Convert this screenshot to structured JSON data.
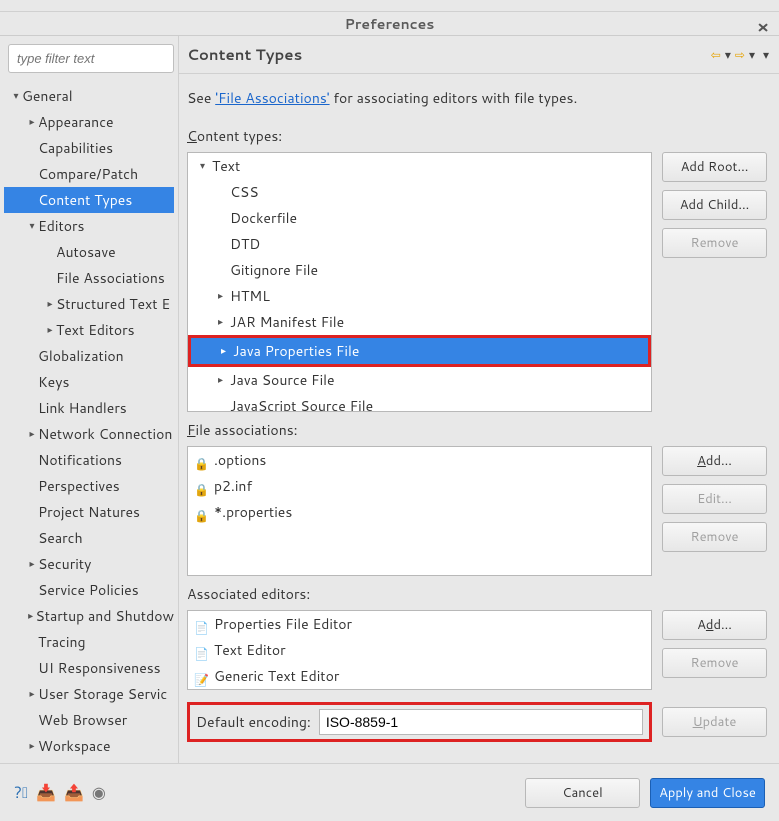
{
  "window": {
    "title": "Preferences"
  },
  "sidebar": {
    "filter_placeholder": "type filter text",
    "tree": {
      "general": {
        "label": "General",
        "children": [
          {
            "label": "Appearance"
          },
          {
            "label": "Capabilities"
          },
          {
            "label": "Compare/Patch"
          },
          {
            "label": "Content Types"
          },
          {
            "label": "Editors",
            "children": [
              {
                "label": "Autosave"
              },
              {
                "label": "File Associations"
              },
              {
                "label": "Structured Text E"
              },
              {
                "label": "Text Editors"
              }
            ]
          },
          {
            "label": "Globalization"
          },
          {
            "label": "Keys"
          },
          {
            "label": "Link Handlers"
          },
          {
            "label": "Network Connection"
          },
          {
            "label": "Notifications"
          },
          {
            "label": "Perspectives"
          },
          {
            "label": "Project Natures"
          },
          {
            "label": "Search"
          },
          {
            "label": "Security"
          },
          {
            "label": "Service Policies"
          },
          {
            "label": "Startup and Shutdow"
          },
          {
            "label": "Tracing"
          },
          {
            "label": "UI Responsiveness"
          },
          {
            "label": "User Storage Servic"
          },
          {
            "label": "Web Browser"
          },
          {
            "label": "Workspace"
          }
        ]
      }
    }
  },
  "main": {
    "title": "Content Types",
    "info_prefix": "See ",
    "info_link": "'File Associations'",
    "info_suffix": " for associating editors with file types.",
    "content_types_mnemonic": "C",
    "content_types_label": "ontent types:",
    "content_tree": {
      "text": {
        "label": "Text",
        "children": [
          {
            "label": "CSS"
          },
          {
            "label": "Dockerfile"
          },
          {
            "label": "DTD"
          },
          {
            "label": "Gitignore File"
          },
          {
            "label": "HTML"
          },
          {
            "label": "JAR Manifest File"
          },
          {
            "label": "Java Properties File"
          },
          {
            "label": "Java Source File"
          },
          {
            "label": "JavaScript Source File"
          }
        ]
      }
    },
    "file_assoc_mnemonic": "F",
    "file_assoc_label": "ile associations:",
    "file_assoc": [
      ".options",
      "p2.inf",
      "*.properties"
    ],
    "assoc_editors_label": "Associated editors:",
    "assoc_editors": [
      "Properties File Editor",
      "Text Editor",
      "Generic Text Editor"
    ],
    "encoding_label": "Default encoding:",
    "encoding_value": "ISO-8859-1",
    "buttons": {
      "add_root": "Add Root...",
      "add_child": "Add Child...",
      "remove": "Remove",
      "add_u": "A",
      "add_rest": "dd...",
      "edit": "Edit...",
      "remove2": "Remove",
      "add_prefix": "A",
      "add_d": "d",
      "add_suffix": "d...",
      "remove3": "Remove",
      "update_u": "U",
      "update_rest": "pdate"
    }
  },
  "footer": {
    "cancel": "Cancel",
    "apply_close": "Apply and Close"
  }
}
